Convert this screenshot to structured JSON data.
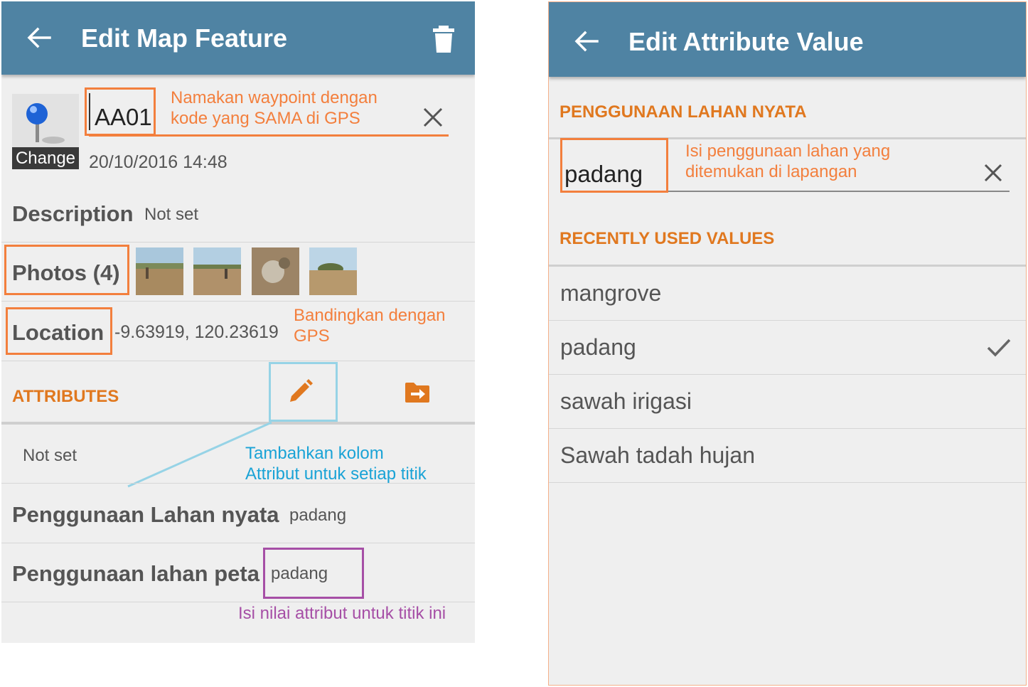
{
  "left_screen": {
    "title": "Edit Map Feature",
    "marker_change_label": "Change",
    "name_value": "AA01",
    "name_note": "Namakan waypoint dengan kode yang SAMA di GPS",
    "name_note_line1": "Namakan waypoint dengan",
    "name_note_line2": "kode yang SAMA di GPS",
    "datetime": "20/10/2016 14:48",
    "description_label": "Description",
    "description_value": "Not set",
    "photos_label": "Photos (4)",
    "photo_count": 4,
    "location_label": "Location",
    "location_value": "-9.63919, 120.23619",
    "location_note_line1": "Bandingkan dengan",
    "location_note_line2": "GPS",
    "attributes_heading": "ATTRIBUTES",
    "attributes_value": "Not set",
    "attributes_note_line1": "Tambahkan kolom",
    "attributes_note_line2": "Attribut untuk setiap titik",
    "attr_rows": [
      {
        "label": "Penggunaan Lahan nyata",
        "value": "padang"
      },
      {
        "label": "Penggunaan lahan peta",
        "value": "padang"
      }
    ],
    "value_note": "Isi nilai attribut untuk titik ini"
  },
  "right_screen": {
    "title": "Edit Attribute Value",
    "field_heading": "PENGGUNAAN LAHAN NYATA",
    "input_value": "padang",
    "input_note_line1": "Isi penggunaan lahan yang",
    "input_note_line2": "ditemukan di lapangan",
    "recent_heading": "RECENTLY USED VALUES",
    "recent_values": [
      "mangrove",
      "padang",
      "sawah irigasi",
      "Sawah tadah hujan"
    ],
    "selected_value": "padang"
  },
  "colors": {
    "appbar": "#4f83a3",
    "accent_orange": "#f37f3d",
    "section_orange": "#e0781f",
    "note_blue": "#1aa3d6",
    "note_purple": "#a64fa6",
    "background": "#efefef"
  },
  "icons": [
    "back-arrow-icon",
    "trash-icon",
    "map-pin-icon",
    "close-icon",
    "pencil-icon",
    "folder-arrow-icon",
    "checkmark-icon"
  ]
}
